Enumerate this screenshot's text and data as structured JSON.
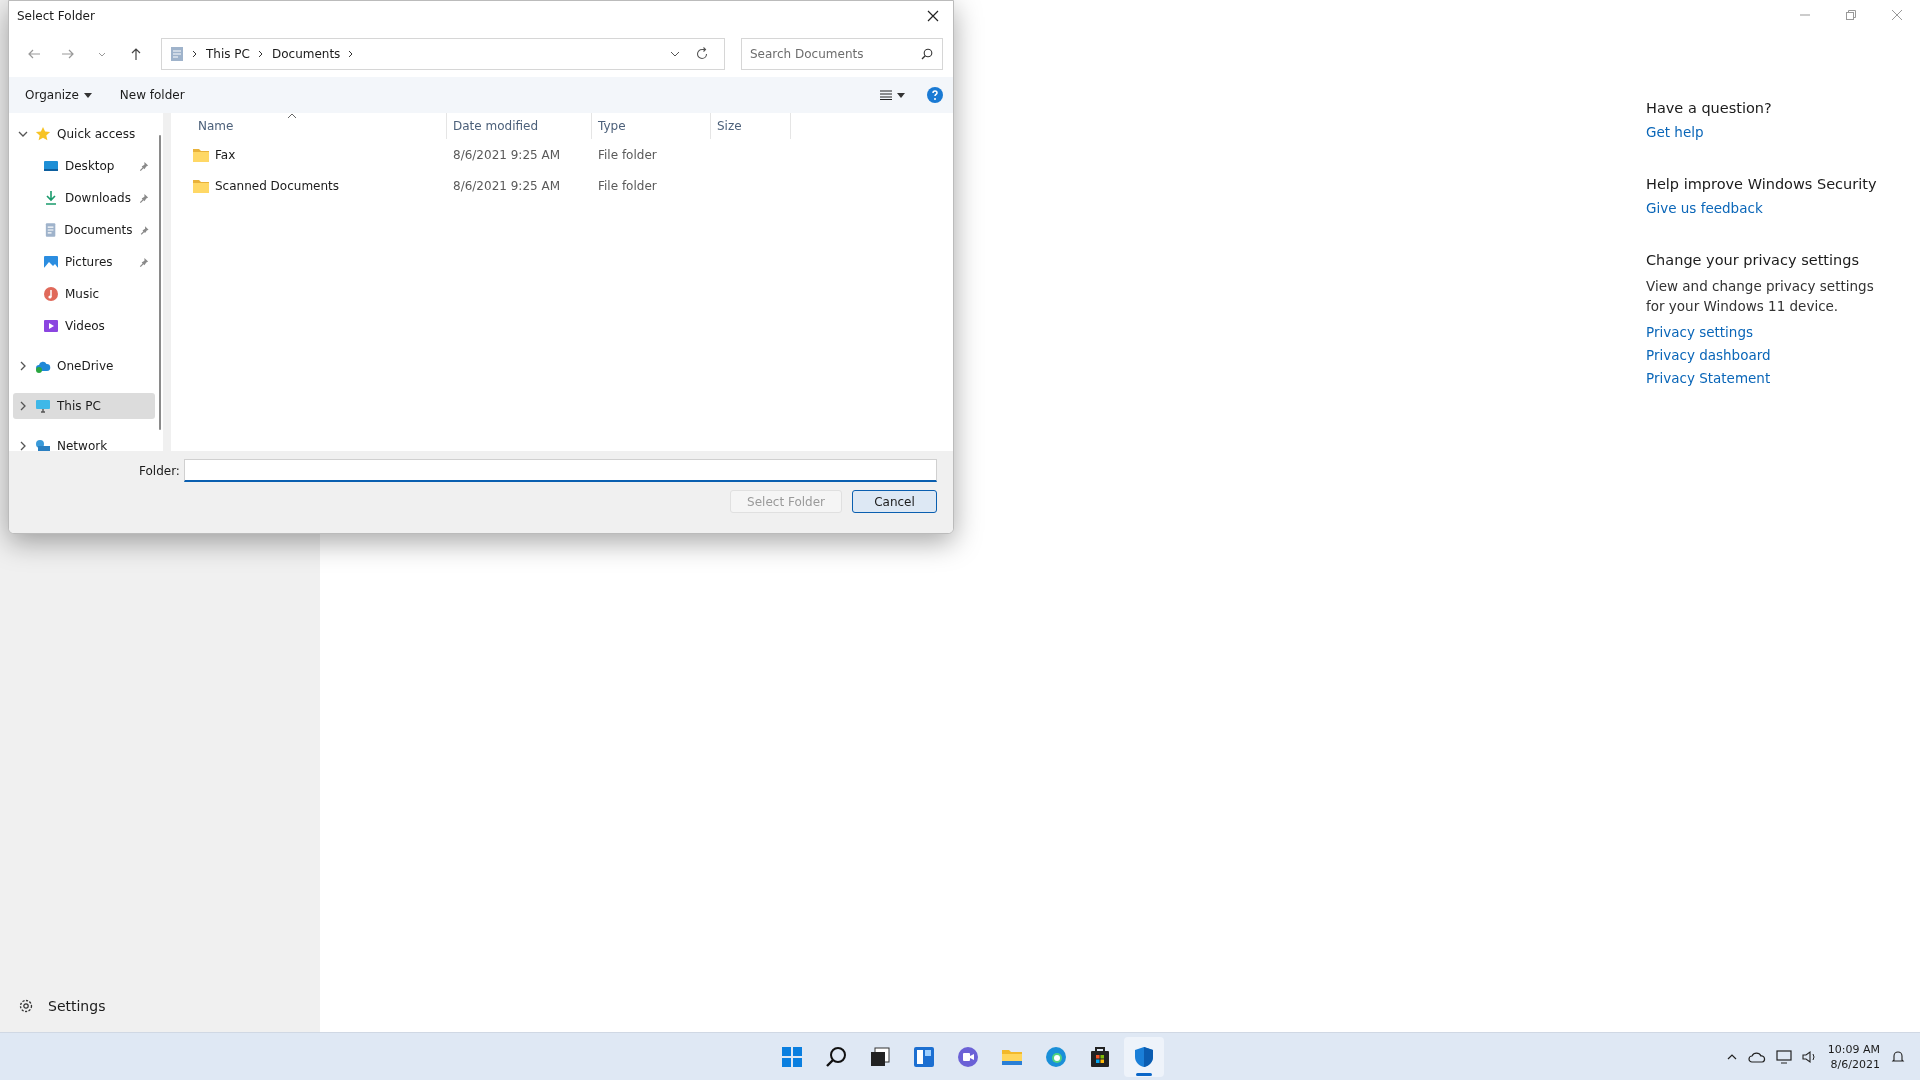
{
  "dialog": {
    "title": "Select Folder",
    "address": {
      "segments": [
        "This PC",
        "Documents"
      ]
    },
    "search": {
      "placeholder": "Search Documents"
    },
    "commands": [
      {
        "label": "Organize",
        "menu": true
      },
      {
        "label": "New folder",
        "menu": false
      }
    ],
    "nav_tree": [
      {
        "label": "Quick access",
        "kind": "star",
        "expanded": true,
        "selected": false,
        "children": [
          {
            "label": "Desktop",
            "kind": "desktop",
            "pinned": true
          },
          {
            "label": "Downloads",
            "kind": "download",
            "pinned": true
          },
          {
            "label": "Documents",
            "kind": "document",
            "pinned": true
          },
          {
            "label": "Pictures",
            "kind": "pictures",
            "pinned": true
          },
          {
            "label": "Music",
            "kind": "music",
            "pinned": false
          },
          {
            "label": "Videos",
            "kind": "videos",
            "pinned": false
          }
        ]
      },
      {
        "label": "OneDrive",
        "kind": "cloud",
        "expanded": false,
        "selected": false
      },
      {
        "label": "This PC",
        "kind": "pc",
        "expanded": false,
        "selected": true
      },
      {
        "label": "Network",
        "kind": "network",
        "expanded": false,
        "selected": false
      }
    ],
    "columns": [
      {
        "label": "Name",
        "sorted": true
      },
      {
        "label": "Date modified",
        "sorted": false
      },
      {
        "label": "Type",
        "sorted": false
      },
      {
        "label": "Size",
        "sorted": false
      }
    ],
    "rows": [
      {
        "name": "Fax",
        "date": "8/6/2021 9:25 AM",
        "type": "File folder"
      },
      {
        "name": "Scanned Documents",
        "date": "8/6/2021 9:25 AM",
        "type": "File folder"
      }
    ],
    "folder_field": {
      "label": "Folder:"
    },
    "buttons": [
      {
        "label": "Select Folder",
        "disabled": true,
        "default": false
      },
      {
        "label": "Cancel",
        "disabled": false,
        "default": true
      }
    ]
  },
  "app": {
    "settings_label": "Settings",
    "sections": [
      {
        "heading": "Have a question?",
        "links": [
          "Get help"
        ]
      },
      {
        "heading": "Help improve Windows Security",
        "links": [
          "Give us feedback"
        ]
      },
      {
        "heading": "Change your privacy settings",
        "body": "View and change privacy settings for your Windows 11 device.",
        "links": [
          "Privacy settings",
          "Privacy dashboard",
          "Privacy Statement"
        ]
      }
    ]
  },
  "taskbar": {
    "apps": [
      {
        "kind": "start",
        "selected": false
      },
      {
        "kind": "search",
        "selected": false
      },
      {
        "kind": "taskview",
        "selected": false
      },
      {
        "kind": "widgets",
        "selected": false
      },
      {
        "kind": "chat",
        "selected": false
      },
      {
        "kind": "folder",
        "selected": false
      },
      {
        "kind": "browser",
        "selected": false
      },
      {
        "kind": "store",
        "selected": false
      },
      {
        "kind": "shield",
        "selected": true
      }
    ],
    "time": "10:09 AM",
    "date": "8/6/2021"
  }
}
